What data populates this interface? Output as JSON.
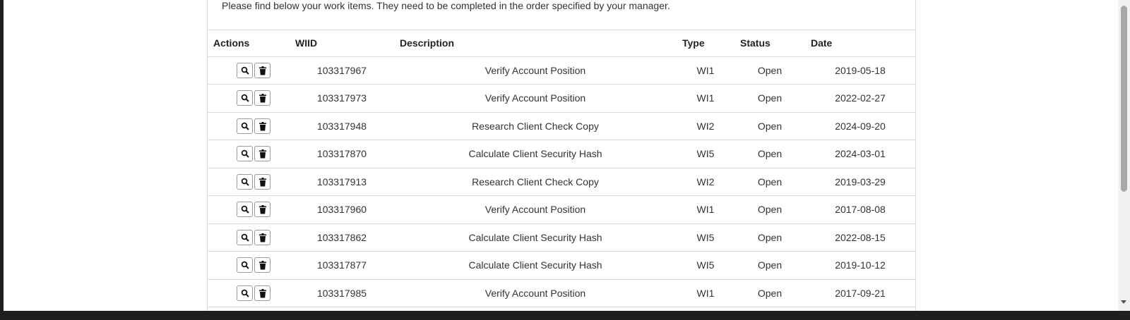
{
  "intro_text": "Please find below your work items. They need to be completed in the order specified by your manager.",
  "table": {
    "headers": {
      "actions": "Actions",
      "wiid": "WIID",
      "description": "Description",
      "type": "Type",
      "status": "Status",
      "date": "Date"
    },
    "rows": [
      {
        "wiid": "103317967",
        "description": "Verify Account Position",
        "type": "WI1",
        "status": "Open",
        "date": "2019-05-18"
      },
      {
        "wiid": "103317973",
        "description": "Verify Account Position",
        "type": "WI1",
        "status": "Open",
        "date": "2022-02-27"
      },
      {
        "wiid": "103317948",
        "description": "Research Client Check Copy",
        "type": "WI2",
        "status": "Open",
        "date": "2024-09-20"
      },
      {
        "wiid": "103317870",
        "description": "Calculate Client Security Hash",
        "type": "WI5",
        "status": "Open",
        "date": "2024-03-01"
      },
      {
        "wiid": "103317913",
        "description": "Research Client Check Copy",
        "type": "WI2",
        "status": "Open",
        "date": "2019-03-29"
      },
      {
        "wiid": "103317960",
        "description": "Verify Account Position",
        "type": "WI1",
        "status": "Open",
        "date": "2017-08-08"
      },
      {
        "wiid": "103317862",
        "description": "Calculate Client Security Hash",
        "type": "WI5",
        "status": "Open",
        "date": "2022-08-15"
      },
      {
        "wiid": "103317877",
        "description": "Calculate Client Security Hash",
        "type": "WI5",
        "status": "Open",
        "date": "2019-10-12"
      },
      {
        "wiid": "103317985",
        "description": "Verify Account Position",
        "type": "WI1",
        "status": "Open",
        "date": "2017-09-21"
      }
    ]
  },
  "icons": {
    "view": "search-icon",
    "delete": "trash-icon"
  }
}
